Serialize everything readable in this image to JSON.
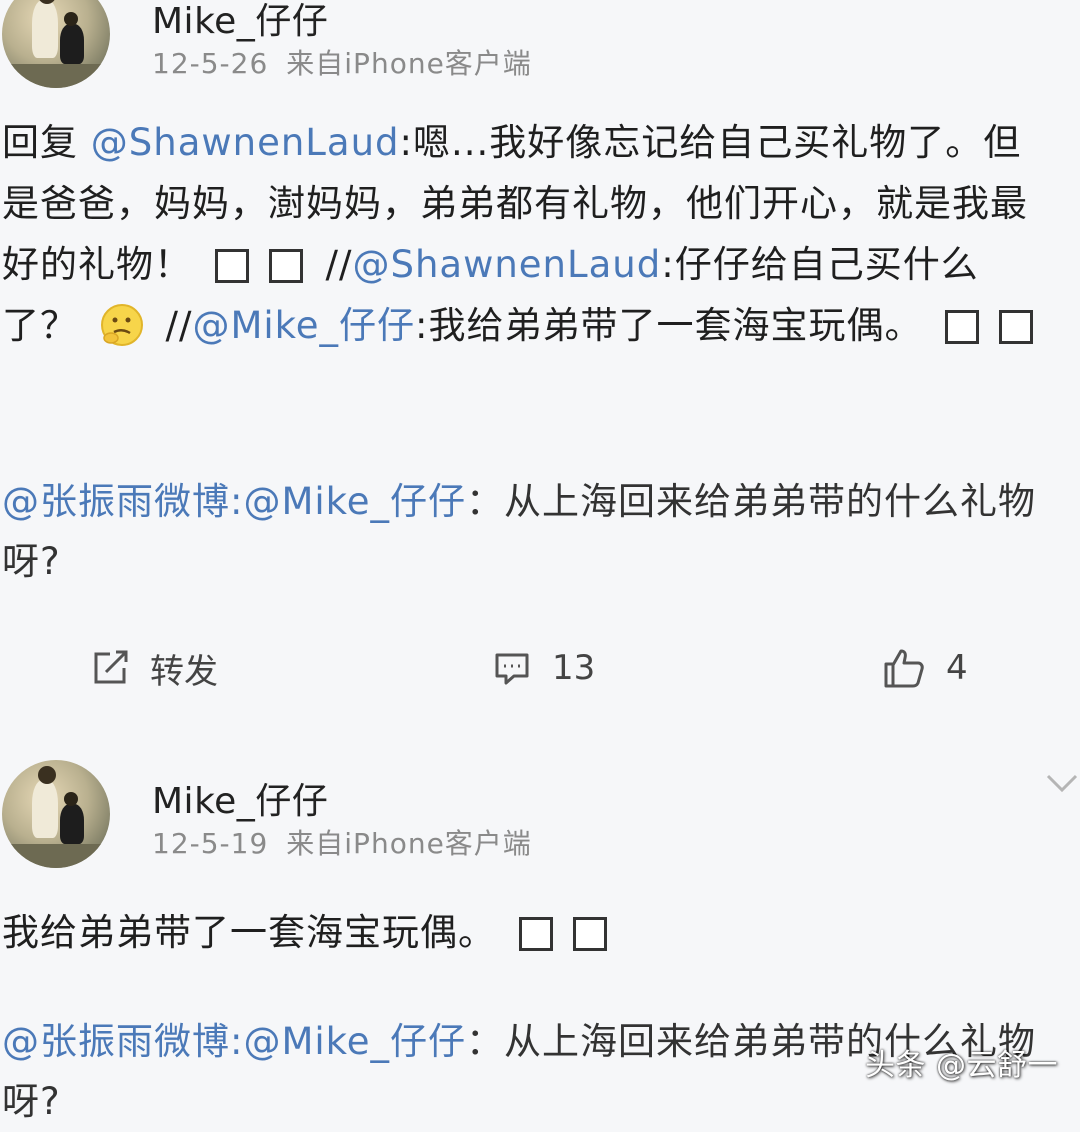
{
  "posts": [
    {
      "username": "Mike_仔仔",
      "date": "12-5-26",
      "source": "来自iPhone客户端",
      "body": {
        "prefix": "回复",
        "mention1": "@ShawnenLaud",
        "text1": ":嗯...我好像忘记给自己买礼物了。但是爸爸，妈妈，澍妈妈，弟弟都有礼物，他们开心，就是我最好的礼物！",
        "sep1": " //",
        "mention2": "@ShawnenLaud",
        "text2": ":仔仔给自己买什么了？",
        "sep2": " //",
        "mention3": "@Mike_仔仔",
        "text3": ":我给弟弟带了一套海宝玩偶。"
      },
      "quote": {
        "author": "@张振雨微博",
        "mention": ":@Mike_仔仔",
        "text": "：从上海回来给弟弟带的什么礼物呀?"
      },
      "actions": {
        "repost_label": "转发",
        "comment_count": "13",
        "like_count": "4"
      }
    },
    {
      "username": "Mike_仔仔",
      "date": "12-5-19",
      "source": "来自iPhone客户端",
      "body": {
        "text": "我给弟弟带了一套海宝玩偶。"
      },
      "quote": {
        "author": "@张振雨微博",
        "mention": ":@Mike_仔仔",
        "text": "：从上海回来给弟弟带的什么礼物呀?"
      }
    }
  ],
  "watermark": "头条 @云舒一",
  "colors": {
    "background": "#f6f7f9",
    "mention": "#4b79b8",
    "meta": "#8a8a8a",
    "text": "#1f1f1f"
  },
  "icons": {
    "repost": "repost-icon",
    "comment": "comment-icon",
    "like": "thumbs-up-icon",
    "expand": "chevron-down-icon"
  }
}
